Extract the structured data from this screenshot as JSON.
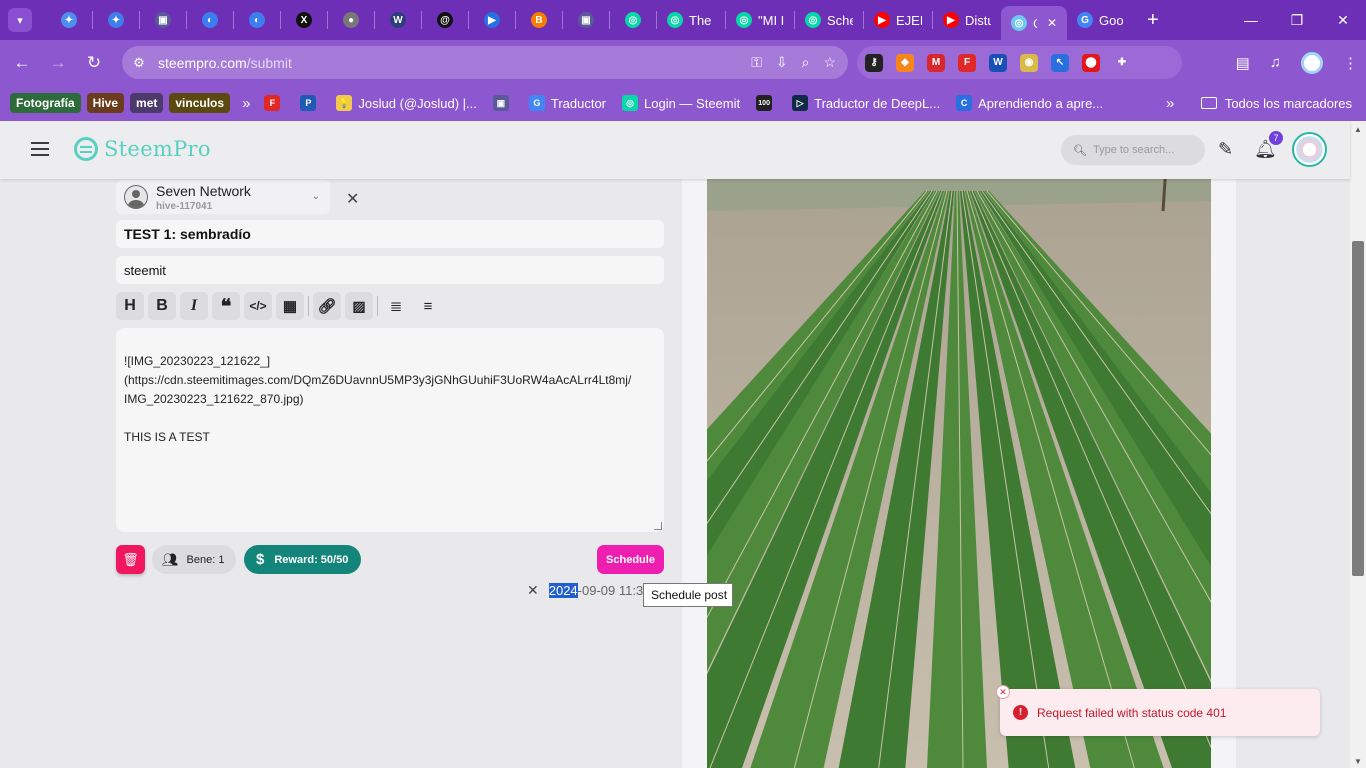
{
  "browser": {
    "tabs": [
      {
        "icon": "gemini-icon",
        "glyph": "✦",
        "color": "#4d8ef0",
        "label": ""
      },
      {
        "icon": "gemini-icon",
        "glyph": "✦",
        "color": "#3f7ee8",
        "label": ""
      },
      {
        "icon": "app-icon",
        "glyph": "▣",
        "color": "#5a5a9a",
        "label": ""
      },
      {
        "icon": "messenger-icon",
        "glyph": "◐",
        "color": "#3c7ef0",
        "label": ""
      },
      {
        "icon": "messenger-icon",
        "glyph": "◐",
        "color": "#3c7ef0",
        "label": ""
      },
      {
        "icon": "x-icon",
        "glyph": "X",
        "color": "#111111",
        "label": ""
      },
      {
        "icon": "globe-icon",
        "glyph": "●",
        "color": "#777777",
        "label": ""
      },
      {
        "icon": "wordpress-icon",
        "glyph": "W",
        "color": "#2c3e7a",
        "label": ""
      },
      {
        "icon": "threads-icon",
        "glyph": "@",
        "color": "#111111",
        "label": ""
      },
      {
        "icon": "flag-icon",
        "glyph": "▶",
        "color": "#2a6fe0",
        "label": ""
      },
      {
        "icon": "blogger-icon",
        "glyph": "B",
        "color": "#f57d00",
        "label": ""
      },
      {
        "icon": "app-icon",
        "glyph": "▣",
        "color": "#5a5a9a",
        "label": ""
      },
      {
        "icon": "steem-icon",
        "glyph": "◎",
        "color": "#07d7a9",
        "label": ""
      }
    ],
    "wide_tabs": [
      {
        "icon": "steem-icon",
        "glyph": "◎",
        "color": "#07d7a9",
        "label": "The I"
      },
      {
        "icon": "steem-icon",
        "glyph": "◎",
        "color": "#07d7a9",
        "label": "\"MI I"
      },
      {
        "icon": "steem-icon",
        "glyph": "◎",
        "color": "#07d7a9",
        "label": "Sche"
      },
      {
        "icon": "youtube-icon",
        "glyph": "▶",
        "color": "#ff0000",
        "label": "EJEM"
      },
      {
        "icon": "youtube-icon",
        "glyph": "▶",
        "color": "#ff0000",
        "label": "Distu"
      }
    ],
    "active_tab": {
      "icon": "steempro-icon",
      "glyph": "◎",
      "color": "#6fc7f0",
      "label": "C"
    },
    "last_tab": {
      "icon": "google-translate-icon",
      "glyph": "G",
      "color": "#4285f4",
      "label": "Goo"
    },
    "url_domain": "steempro.com",
    "url_path": "/submit",
    "extensions": [
      {
        "icon": "key-icon",
        "glyph": "⚷",
        "color": "#222222"
      },
      {
        "icon": "metamask-icon",
        "glyph": "◆",
        "color": "#f6851b"
      },
      {
        "icon": "mega-icon",
        "glyph": "M",
        "color": "#d9272e"
      },
      {
        "icon": "flipboard-icon",
        "glyph": "F",
        "color": "#e12828"
      },
      {
        "icon": "w-extension-icon",
        "glyph": "W",
        "color": "#1a4fb8"
      },
      {
        "icon": "coin-icon",
        "glyph": "◉",
        "color": "#d9b94a"
      },
      {
        "icon": "cursor-icon",
        "glyph": "↖",
        "color": "#2a6fe0"
      },
      {
        "icon": "keychain-icon",
        "glyph": "⬤",
        "color": "#e3161c"
      },
      {
        "icon": "puzzle-icon",
        "glyph": "✚",
        "color": "#9b6ad6"
      }
    ],
    "bookmarks": {
      "chips": [
        {
          "label": "Fotografía",
          "color": "#2e6b3a"
        },
        {
          "label": "Hive",
          "color": "#6b3b1e"
        },
        {
          "label": "met",
          "color": "#4b3a6b"
        },
        {
          "label": "vinculos",
          "color": "#5b4a10"
        }
      ],
      "items": [
        {
          "icon": "flipboard-icon",
          "glyph": "F",
          "color": "#e12828",
          "label": ""
        },
        {
          "icon": "p-icon",
          "glyph": "P",
          "color": "#1f5bb5",
          "label": ""
        },
        {
          "icon": "bulb-icon",
          "glyph": "💡",
          "color": "#f2c94c",
          "label": "Joslud (@Joslud) |..."
        },
        {
          "icon": "app-icon",
          "glyph": "▣",
          "color": "#5a5a9a",
          "label": ""
        },
        {
          "icon": "google-translate-icon",
          "glyph": "G",
          "color": "#4285f4",
          "label": "Traductor"
        },
        {
          "icon": "steem-icon",
          "glyph": "◎",
          "color": "#07d7a9",
          "label": "Login — Steemit"
        },
        {
          "icon": "100-icon",
          "glyph": "100",
          "color": "#222222",
          "label": ""
        },
        {
          "icon": "deepl-icon",
          "glyph": "▷",
          "color": "#0f2b46",
          "label": "Traductor de DeepL..."
        },
        {
          "icon": "c-icon",
          "glyph": "C",
          "color": "#2a6fe0",
          "label": "Aprendiendo a apre..."
        }
      ],
      "all_bookmarks": "Todos los marcadores"
    }
  },
  "app": {
    "logo_text": "SteemPro",
    "search_placeholder": "Type to search...",
    "notification_count": "7",
    "account": {
      "name": "Seven Network",
      "id": "hive-117041"
    },
    "post": {
      "title": "TEST 1: sembradío",
      "tags": "steemit",
      "body_lines": [
        "![IMG_20230223_121622_]",
        "(https://cdn.steemitimages.com/DQmZ6DUavnnU5MP3y3jGNhGUuhiF3UoRW4aAcALrr4Lt8mj/",
        "IMG_20230223_121622_870.jpg)",
        "",
        "THIS IS A TEST"
      ]
    },
    "toolbar_buttons": [
      "heading-icon",
      "bold-icon",
      "italic-icon",
      "quote-icon",
      "code-icon",
      "table-icon",
      "link-icon",
      "image-icon",
      "align-justify-icon",
      "align-center-icon"
    ],
    "bene_label": "Bene: 1",
    "reward_label": "Reward: 50/50",
    "schedule_label": "Schedule",
    "schedule_value_selected": "2024",
    "schedule_value_rest": "-09-09 11:30",
    "tooltip": "Schedule post",
    "toast_message": "Request failed with status code 401",
    "colors": {
      "accent_teal": "#14857a",
      "schedule_pink": "#ee1fb0",
      "delete_red": "#f0175f",
      "error_red": "#d81f2e",
      "browser_purple": "#8d57cf"
    }
  }
}
